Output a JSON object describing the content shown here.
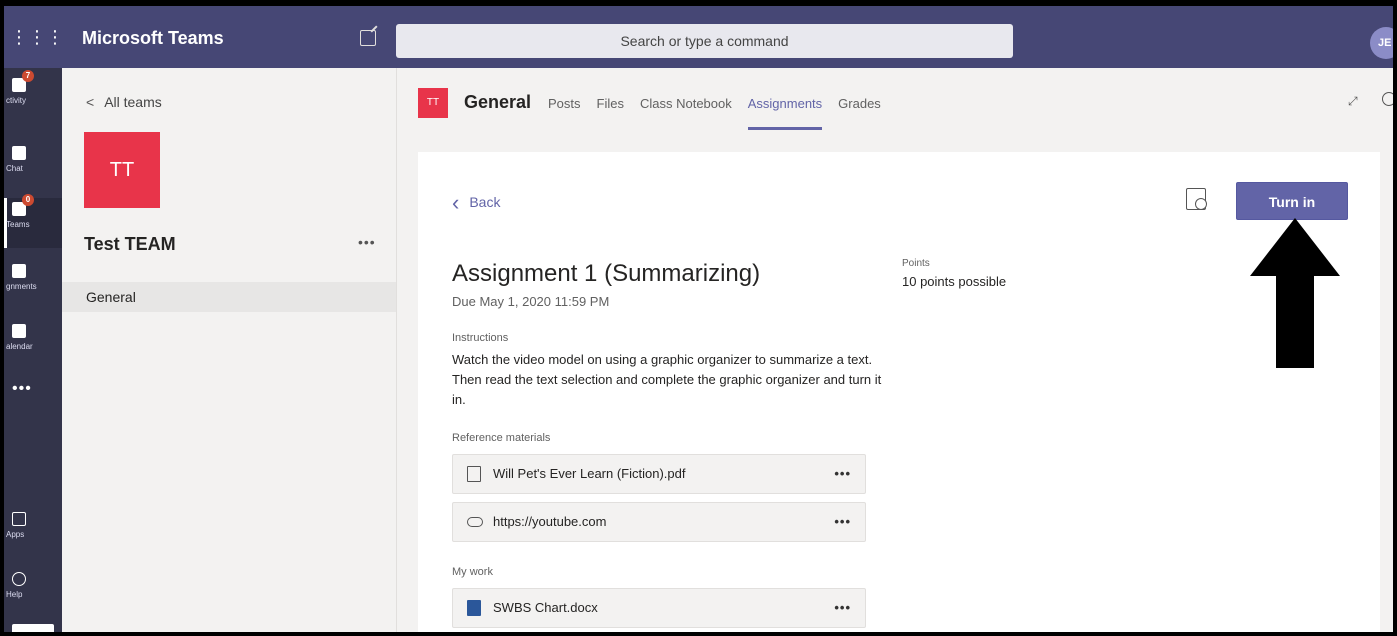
{
  "app": {
    "title": "Microsoft Teams",
    "search_placeholder": "Search or type a command",
    "avatar_initials": "JE"
  },
  "rail": {
    "items": [
      {
        "label": "ctivity",
        "badge": "7"
      },
      {
        "label": "Chat",
        "badge": ""
      },
      {
        "label": "Teams",
        "badge": "0"
      },
      {
        "label": "gnments",
        "badge": ""
      },
      {
        "label": "alendar",
        "badge": ""
      },
      {
        "label": "Apps",
        "badge": ""
      },
      {
        "label": "Help",
        "badge": ""
      }
    ],
    "more": "•••"
  },
  "teams_panel": {
    "back_label": "All teams",
    "team_initials": "TT",
    "team_name": "Test TEAM",
    "team_more": "•••",
    "channels": [
      "General"
    ]
  },
  "channel": {
    "initials": "TT",
    "name": "General",
    "tabs": [
      "Posts",
      "Files",
      "Class Notebook",
      "Assignments",
      "Grades"
    ],
    "active_tab": "Assignments"
  },
  "assignment": {
    "back_label": "Back",
    "turn_in_label": "Turn in",
    "title": "Assignment 1 (Summarizing)",
    "due": "Due May 1, 2020 11:59 PM",
    "points_label": "Points",
    "points_value": "10 points possible",
    "instructions_label": "Instructions",
    "instructions_text": "Watch the video model on using a graphic organizer to summarize a text. Then read the text selection and complete the graphic organizer and turn it in.",
    "reference_label": "Reference materials",
    "references": [
      {
        "name": "Will Pet's Ever Learn (Fiction).pdf",
        "icon": "pdf-file-icon"
      },
      {
        "name": "https://youtube.com",
        "icon": "link-icon"
      }
    ],
    "my_work_label": "My work",
    "my_work": [
      {
        "name": "SWBS Chart.docx",
        "icon": "word-file-icon"
      }
    ],
    "more": "•••"
  },
  "colors": {
    "teams_purple": "#464775",
    "accent": "#6264a7",
    "team_red": "#e8344a"
  }
}
